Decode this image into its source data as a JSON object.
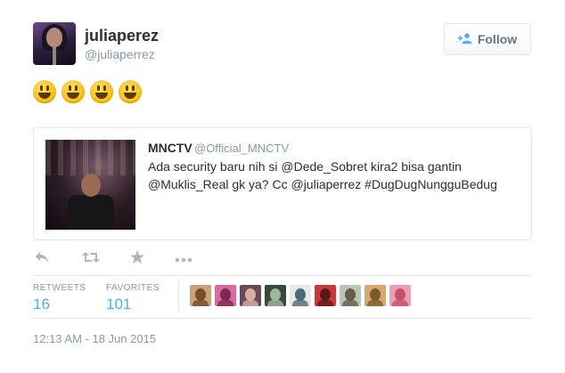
{
  "header": {
    "fullname": "juliaperez",
    "username": "@juliaperrez",
    "follow_label": "Follow",
    "follow_icon": "person-plus-icon"
  },
  "tweet": {
    "emoji_name": "grinning-face",
    "emoji_count": 4
  },
  "quoted": {
    "name": "MNCTV",
    "handle": "@Official_MNCTV",
    "line1": "Ada security baru nih si @Dede_Sobret kira2 bisa gantin",
    "line2": "@Muklis_Real gk ya? Cc @juliaperrez  #DugDugNungguBedug"
  },
  "actions": [
    "reply-icon",
    "retweet-icon",
    "favorite-icon",
    "more-icon"
  ],
  "stats": {
    "retweets_label": "RETWEETS",
    "retweets_value": "16",
    "favorites_label": "FAVORITES",
    "favorites_value": "101"
  },
  "favoriters": [
    {
      "bg": "#c9a27a",
      "fg": "#7a4a2a"
    },
    {
      "bg": "#d86aa0",
      "fg": "#7a2a50"
    },
    {
      "bg": "#6a4a5a",
      "fg": "#d8b0a0"
    },
    {
      "bg": "#3a4a3a",
      "fg": "#a0b8a0"
    },
    {
      "bg": "#e8e8e8",
      "fg": "#4a6a7a"
    },
    {
      "bg": "#c83a3a",
      "fg": "#5a1a1a"
    },
    {
      "bg": "#b8c8b8",
      "fg": "#6a5a4a"
    },
    {
      "bg": "#d8a870",
      "fg": "#7a5a2a"
    },
    {
      "bg": "#e8a0b8",
      "fg": "#c8506a"
    }
  ],
  "timestamp": "12:13 AM - 18 Jun 2015",
  "colors": {
    "accent": "#55acee",
    "muted": "#8899a6",
    "border": "#e1e8ed",
    "text": "#292f33"
  }
}
